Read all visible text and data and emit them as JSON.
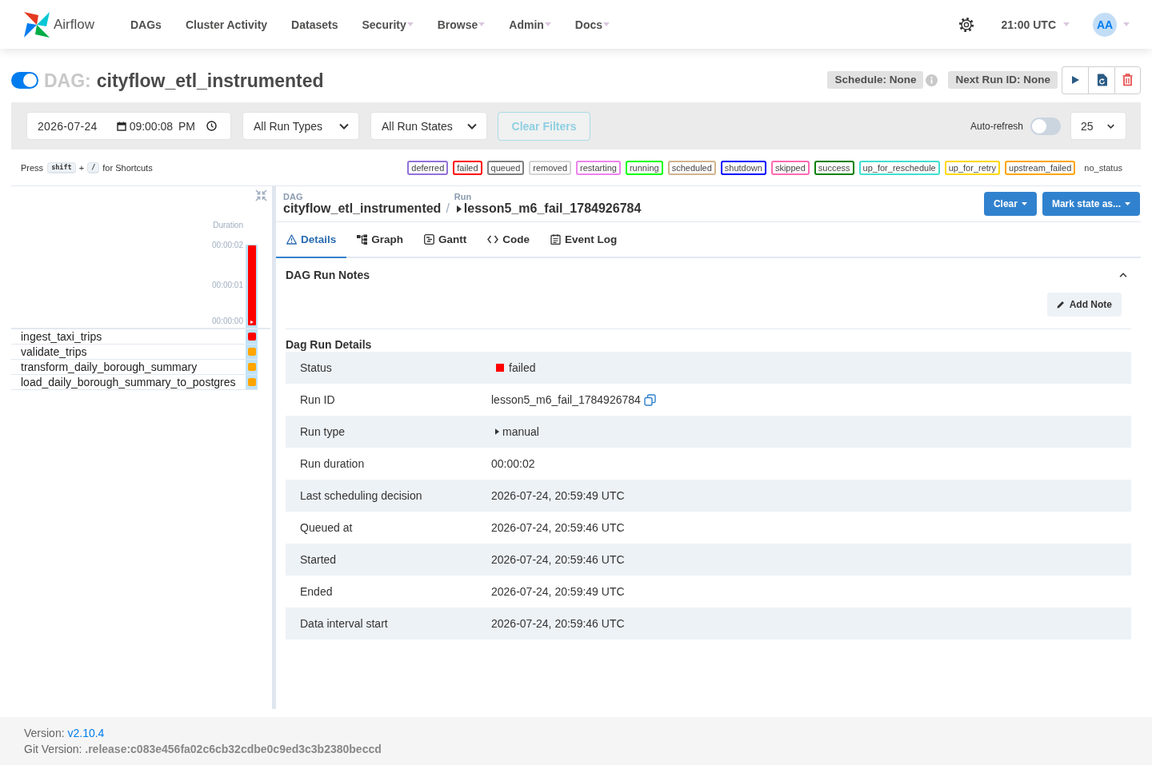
{
  "navbar": {
    "brand": "Airflow",
    "items": [
      {
        "label": "DAGs",
        "has_menu": false
      },
      {
        "label": "Cluster Activity",
        "has_menu": false
      },
      {
        "label": "Datasets",
        "has_menu": false
      },
      {
        "label": "Security",
        "has_menu": true
      },
      {
        "label": "Browse",
        "has_menu": true
      },
      {
        "label": "Admin",
        "has_menu": true
      },
      {
        "label": "Docs",
        "has_menu": true
      }
    ],
    "time": "21:00 UTC",
    "user_initials": "AA"
  },
  "dag_header": {
    "active": true,
    "prefix": "DAG:",
    "dag_id": "cityflow_etl_instrumented",
    "schedule": "Schedule: None",
    "next_run": "Next Run ID: None"
  },
  "filters": {
    "date": "2026-07-24",
    "time": "09:00:08 PM",
    "run_type": "All Run Types",
    "run_state": "All Run States",
    "clear_button": {
      "label": "Clear Filters",
      "disabled": true
    },
    "auto_refresh": {
      "label": "Auto-refresh",
      "on": false
    },
    "page_size": "25"
  },
  "shortcuts": {
    "before": "Press",
    "keys": [
      "shift",
      "/"
    ],
    "joiner": "+",
    "after": "for Shortcuts"
  },
  "legend": [
    {
      "label": "deferred",
      "color": "#9370db"
    },
    {
      "label": "failed",
      "color": "#ff0000"
    },
    {
      "label": "queued",
      "color": "#808080"
    },
    {
      "label": "removed",
      "color": "#d3d3d3"
    },
    {
      "label": "restarting",
      "color": "#ee82ee"
    },
    {
      "label": "running",
      "color": "#00ff00"
    },
    {
      "label": "scheduled",
      "color": "#d2b48c"
    },
    {
      "label": "shutdown",
      "color": "#0000ff"
    },
    {
      "label": "skipped",
      "color": "#ff69b4"
    },
    {
      "label": "success",
      "color": "#008000"
    },
    {
      "label": "up_for_reschedule",
      "color": "#40e0d0"
    },
    {
      "label": "up_for_retry",
      "color": "#ffd700"
    },
    {
      "label": "upstream_failed",
      "color": "#ffa500"
    },
    {
      "label": "no_status"
    }
  ],
  "grid": {
    "chart_data": {
      "type": "bar",
      "ylabel": "Duration",
      "ylim": [
        0,
        2
      ],
      "yticks": [
        {
          "value": 0,
          "label": "00:00:00"
        },
        {
          "value": 1,
          "label": "00:00:01"
        },
        {
          "value": 2,
          "label": "00:00:02"
        }
      ],
      "series": [
        {
          "color": "#ff0000",
          "values": [
            2
          ]
        }
      ]
    },
    "tasks": [
      {
        "name": "ingest_taxi_trips",
        "color": "#ff0000"
      },
      {
        "name": "validate_trips",
        "color": "#ffa500"
      },
      {
        "name": "transform_daily_borough_summary",
        "color": "#ffa500"
      },
      {
        "name": "load_daily_borough_summary_to_postgres",
        "color": "#ffa500"
      }
    ]
  },
  "run_panel": {
    "breadcrumb": {
      "dag_label": "DAG",
      "dag_id": "cityflow_etl_instrumented",
      "separator": "/",
      "run_label": "Run",
      "run_id": "lesson5_m6_fail_1784926784"
    },
    "actions": [
      "Clear",
      "Mark state as..."
    ],
    "tabs": [
      {
        "label": "Details",
        "kind": "details",
        "selected": true
      },
      {
        "label": "Graph",
        "kind": "graph",
        "selected": false
      },
      {
        "label": "Gantt",
        "kind": "gantt",
        "selected": false
      },
      {
        "label": "Code",
        "kind": "code",
        "selected": false
      },
      {
        "label": "Event Log",
        "kind": "log",
        "selected": false
      }
    ],
    "notes": {
      "title": "DAG Run Notes",
      "expanded": true,
      "add_button": "Add Note"
    },
    "details": {
      "title": "Dag Run Details",
      "rows": [
        {
          "kind": "status",
          "label": "Status",
          "value": "failed",
          "color": "#ff0000"
        },
        {
          "kind": "copy",
          "label": "Run ID",
          "value": "lesson5_m6_fail_1784926784"
        },
        {
          "kind": "run_type",
          "label": "Run type",
          "value": "manual"
        },
        {
          "kind": "text",
          "label": "Run duration",
          "value": "00:00:02"
        },
        {
          "kind": "text",
          "label": "Last scheduling decision",
          "value": "2026-07-24, 20:59:49 UTC"
        },
        {
          "kind": "text",
          "label": "Queued at",
          "value": "2026-07-24, 20:59:46 UTC"
        },
        {
          "kind": "text",
          "label": "Started",
          "value": "2026-07-24, 20:59:46 UTC"
        },
        {
          "kind": "text",
          "label": "Ended",
          "value": "2026-07-24, 20:59:49 UTC"
        },
        {
          "kind": "text",
          "label": "Data interval start",
          "value": "2026-07-24, 20:59:46 UTC"
        }
      ]
    }
  },
  "footer": {
    "version_label": "Version:",
    "version": "v2.10.4",
    "git_version": "Git Version: **.release:c083e456fa02c6cb32cdbe0c9ed3c3b2380beccd**"
  }
}
